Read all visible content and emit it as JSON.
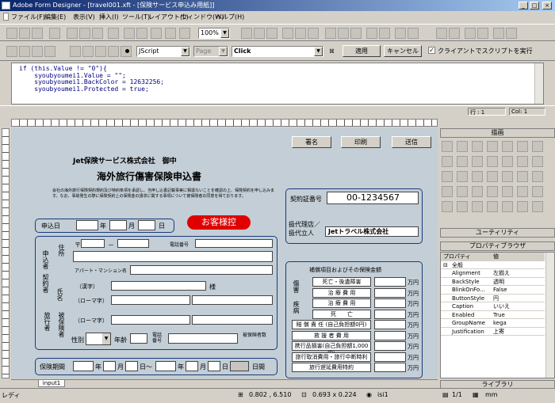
{
  "window": {
    "title": "Adobe Form Designer - [travel001.xft - [保険サービス申込み用紙]]"
  },
  "menu": [
    "ファイル(F)",
    "編集(E)",
    "表示(V)",
    "挿入(I)",
    "ツール(T)",
    "レイアウト(L)",
    "ウィンドウ(W)",
    "ヘルプ(H)"
  ],
  "toolbar": {
    "zoom": "100%"
  },
  "script_bar": {
    "language": "JScript",
    "page": "Page",
    "event": "Click",
    "apply": "適用",
    "cancel": "キャンセル",
    "client_label": "クライアントでスクリプトを実行"
  },
  "code": [
    "if (this.Value != \"0\"){",
    "    syoubyoumei1.Value = \"\";",
    "    syoubyoumei1.BackColor = 12632256;",
    "    syoubyoumei1.Protected = true;"
  ],
  "code_status": {
    "line": "行 : 1",
    "col": "Col: 1"
  },
  "form": {
    "buttons": [
      "署名",
      "印刷",
      "送信"
    ],
    "company": "Jet保険サービス株式会社　御中",
    "title": "海外旅行傷害保険申込書",
    "notice": "会社の海外旅行保険契約規約及び特約条項を承認し、当申し込書記載事実に相違ないことを確認の上、保険契約を申し込みます。なお、事故発生の際に保険契約上の保険金の請求に関する事項について被保険者の同意を得ております。",
    "stamp": "お客様控",
    "contract_label": "契約証番号",
    "contract_no": "00-1234567",
    "agent_label": "扱代理店／扱代立人",
    "agent_name": "Jetトラベル株式会社",
    "date_label": "申込日",
    "year": "年",
    "month": "月",
    "day": "日",
    "applicant": "申込者",
    "contractor": "契約者",
    "address": "住所",
    "zip": "〒",
    "dash": "－",
    "phone": "電話番号",
    "apt": "アパート・マンション名",
    "kanji": "（漢字）",
    "sama": "様",
    "roman": "（ローマ字）",
    "name": "氏名",
    "insured": "被保険者",
    "traveler": "旅行者",
    "sex": "性別",
    "age": "年齢",
    "phone2": "電話番号",
    "insured_type": "被保険者数",
    "period": "保険期間",
    "nichikan": "日間",
    "coverage_title": "補償項目およびその保険金額",
    "injury": "傷害",
    "illness": "疾病",
    "yen": "万円",
    "coverage_rows": [
      "死亡・後遺障害",
      "治 療 費 用",
      "治 療 費 用",
      "死　　亡",
      "賠 償 責 任 (自己負担額0円)",
      "救 援 者 費 用",
      "携行品損害(自己負担額1,000円)",
      "旅行取消費用・旅行中断時利",
      "旅行遅延費用特約"
    ]
  },
  "tab": "input1",
  "status": {
    "ready": "レディ",
    "pos": "0.802 , 6.510",
    "size": "0.693 x 0.224",
    "object": "isi1",
    "page": "1/1",
    "unit": "mm"
  },
  "panels": {
    "tools_title": "描画",
    "utility": "ユーティリティ",
    "prop_title": "プロパティブラウザ",
    "prop_head_name": "プロパティ",
    "prop_head_value": "値",
    "prop_group": "全般",
    "library": "ライブラリ"
  },
  "properties": [
    {
      "k": "Alignment",
      "v": "左揃え"
    },
    {
      "k": "BackStyle",
      "v": "透明"
    },
    {
      "k": "BlinkOnFo...",
      "v": "False"
    },
    {
      "k": "ButtonStyle",
      "v": "円"
    },
    {
      "k": "Caption",
      "v": "いいえ"
    },
    {
      "k": "Enabled",
      "v": "True"
    },
    {
      "k": "GroupName",
      "v": "kega"
    },
    {
      "k": "Justification",
      "v": "上寄"
    }
  ]
}
